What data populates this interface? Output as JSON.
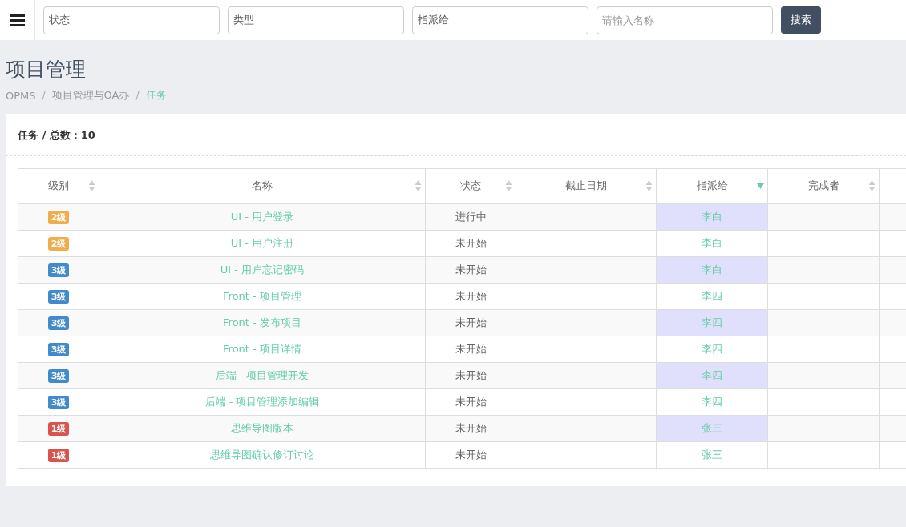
{
  "topbar": {
    "filters": [
      {
        "value": "状态"
      },
      {
        "value": "类型"
      },
      {
        "value": "指派给"
      },
      {
        "placeholder": "请输入名称"
      }
    ],
    "search_button": "搜索"
  },
  "page_title": "项目管理",
  "breadcrumb": {
    "separator": "/",
    "items": [
      {
        "label": "OPMS",
        "current": false
      },
      {
        "label": "项目管理与OA办",
        "current": false
      },
      {
        "label": "任务",
        "current": true
      }
    ]
  },
  "card": {
    "title": "任务 / 总数：10"
  },
  "table": {
    "columns": [
      {
        "label": "级别",
        "sorted": false
      },
      {
        "label": "名称",
        "sorted": false
      },
      {
        "label": "状态",
        "sorted": false
      },
      {
        "label": "截止日期",
        "sorted": false
      },
      {
        "label": "指派给",
        "sorted": true
      },
      {
        "label": "完成者",
        "sorted": false
      },
      {}
    ],
    "rows": [
      {
        "level": "2级",
        "color": "#f0ad4e",
        "name": "UI - 用户登录",
        "status": "进行中",
        "assignee": "李白"
      },
      {
        "level": "2级",
        "color": "#f0ad4e",
        "name": "UI - 用户注册",
        "status": "未开始",
        "assignee": "李白"
      },
      {
        "level": "3级",
        "color": "#428bca",
        "name": "UI - 用户忘记密码",
        "status": "未开始",
        "assignee": "李白"
      },
      {
        "level": "3级",
        "color": "#428bca",
        "name": "Front - 项目管理",
        "status": "未开始",
        "assignee": "李四"
      },
      {
        "level": "3级",
        "color": "#428bca",
        "name": "Front - 发布项目",
        "status": "未开始",
        "assignee": "李四"
      },
      {
        "level": "3级",
        "color": "#428bca",
        "name": "Front - 项目详情",
        "status": "未开始",
        "assignee": "李四"
      },
      {
        "level": "3级",
        "color": "#428bca",
        "name": "后端 - 项目管理开发",
        "status": "未开始",
        "assignee": "李四"
      },
      {
        "level": "3级",
        "color": "#428bca",
        "name": "后端 - 项目管理添加编辑",
        "status": "未开始",
        "assignee": "李四"
      },
      {
        "level": "1级",
        "color": "#d9534f",
        "name": "思维导图版本",
        "status": "未开始",
        "assignee": "张三"
      },
      {
        "level": "1级",
        "color": "#d9534f",
        "name": "思维导图确认修订讨论",
        "status": "未开始",
        "assignee": "张三"
      }
    ]
  }
}
